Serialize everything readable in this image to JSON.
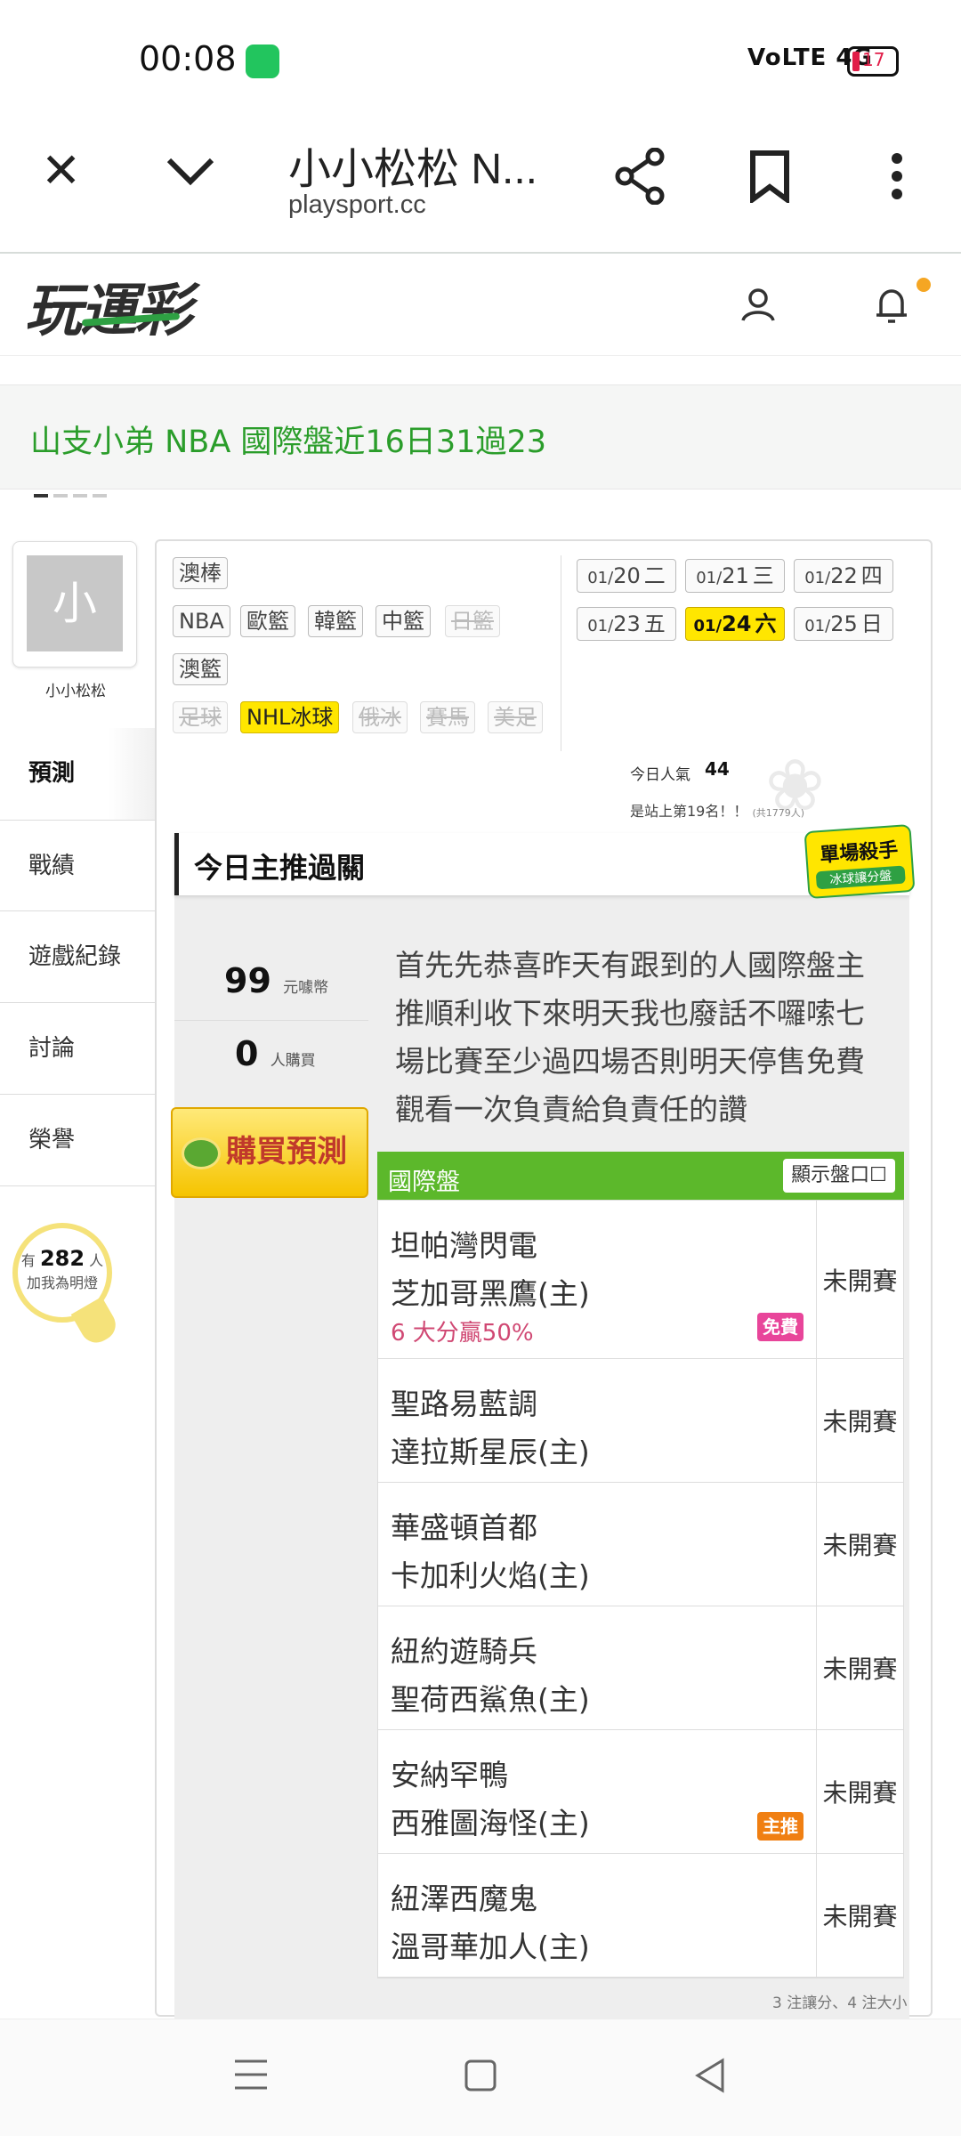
{
  "status_bar": {
    "time": "00:08",
    "signal": "VoLTE 4G",
    "battery": "17"
  },
  "browser": {
    "title": "小小松松 N...",
    "url": "playsport.cc",
    "close_icon": "close-icon",
    "collapse_icon": "chevron-down-icon",
    "share_icon": "share-icon",
    "bookmark_icon": "bookmark-icon",
    "menu_icon": "more-vert-icon"
  },
  "site": {
    "logo": "玩運彩",
    "accent": "#2ea043"
  },
  "banner": {
    "text": "山支小弟  NBA 國際盤近16日31過23"
  },
  "profile": {
    "avatar_initial": "小",
    "name": "小小松松"
  },
  "sidebar": {
    "items": [
      {
        "label": "預測"
      },
      {
        "label": "戰績"
      },
      {
        "label": "遊戲紀錄"
      },
      {
        "label": "討論"
      },
      {
        "label": "榮譽"
      }
    ],
    "fans_prefix": "有",
    "fans_count": "282",
    "fans_unit": "人",
    "fans_text": "加我為明燈"
  },
  "sports": {
    "row1": [
      "澳棒"
    ],
    "row2": [
      "NBA",
      "歐籃",
      "韓籃",
      "中籃",
      "日籃"
    ],
    "row3": [
      "澳籃"
    ],
    "row4": [
      "足球",
      "NHL冰球",
      "俄冰",
      "賽馬",
      "美足"
    ]
  },
  "dates": [
    {
      "md": "01/",
      "d": "20",
      "w": "二"
    },
    {
      "md": "01/",
      "d": "21",
      "w": "三"
    },
    {
      "md": "01/",
      "d": "22",
      "w": "四"
    },
    {
      "md": "01/",
      "d": "23",
      "w": "五"
    },
    {
      "md": "01/",
      "d": "24",
      "w": "六"
    },
    {
      "md": "01/",
      "d": "25",
      "w": "日"
    }
  ],
  "popularity": {
    "label": "今日人氣",
    "value": "44",
    "rank": "是站上第19名！！",
    "rank_note": "(共1779人)"
  },
  "card": {
    "title": "今日主推過關",
    "badge_title": "單場殺手",
    "badge_sub": "冰球讓分盤",
    "price": "99",
    "price_unit": "元噱幣",
    "buyers": "0",
    "buyers_unit": "人購買",
    "buy_button": "購買預測",
    "note": "首先先恭喜昨天有跟到的人國際盤主推順利收下來明天我也廢話不囉嗦七場比賽至少過四場否則明天停售免費觀看一次負責給負責任的讚",
    "market_label": "國際盤",
    "show_button": "顯示盤口",
    "footer": "3 注讓分、4 注大小"
  },
  "games": [
    {
      "away": "坦帕灣閃電",
      "home": "芝加哥黑鷹(主)",
      "status": "未開賽",
      "sub": "6 大分贏50%",
      "tag": "免費"
    },
    {
      "away": "聖路易藍調",
      "home": "達拉斯星辰(主)",
      "status": "未開賽"
    },
    {
      "away": "華盛頓首都",
      "home": "卡加利火焰(主)",
      "status": "未開賽"
    },
    {
      "away": "紐約遊騎兵",
      "home": "聖荷西鯊魚(主)",
      "status": "未開賽"
    },
    {
      "away": "安納罕鴨",
      "home": "西雅圖海怪(主)",
      "status": "未開賽",
      "tag": "主推"
    },
    {
      "away": "紐澤西魔鬼",
      "home": "溫哥華加人(主)",
      "status": "未開賽"
    }
  ]
}
